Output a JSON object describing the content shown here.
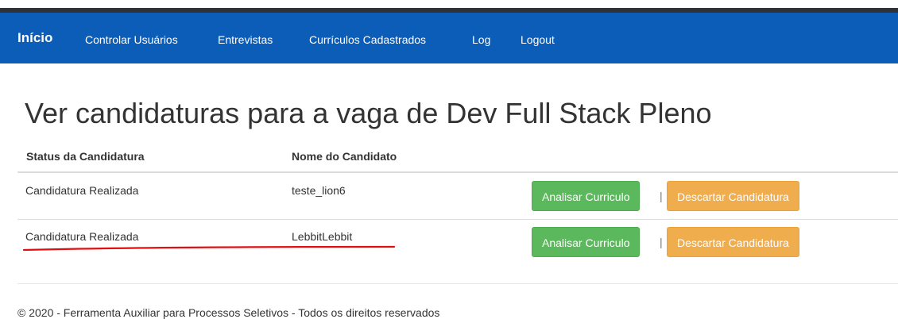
{
  "navbar": {
    "brand": "Início",
    "items": [
      {
        "label": "Controlar Usuários"
      },
      {
        "label": "Entrevistas"
      },
      {
        "label": "Currículos Cadastrados"
      },
      {
        "label": "Log"
      },
      {
        "label": "Logout"
      }
    ],
    "background": "#0b5db8"
  },
  "page": {
    "title": "Ver candidaturas para a vaga de Dev Full Stack Pleno"
  },
  "table": {
    "headers": [
      "Status da Candidatura",
      "Nome do Candidato"
    ],
    "rows": [
      {
        "status": "Candidatura Realizada",
        "name": "teste_lion6",
        "analyze_label": "Analisar Curriculo",
        "separator": "|",
        "discard_label": "Descartar Candidatura"
      },
      {
        "status": "Candidatura Realizada",
        "name": "LebbitLebbit",
        "analyze_label": "Analisar Curriculo",
        "separator": "|",
        "discard_label": "Descartar Candidatura"
      }
    ]
  },
  "footer": {
    "text": "© 2020 - Ferramenta Auxiliar para Processos Seletivos - Todos os direitos reservados"
  },
  "colors": {
    "success": "#5cb85c",
    "warning": "#f0ad4e",
    "annotation": "#e01010"
  }
}
